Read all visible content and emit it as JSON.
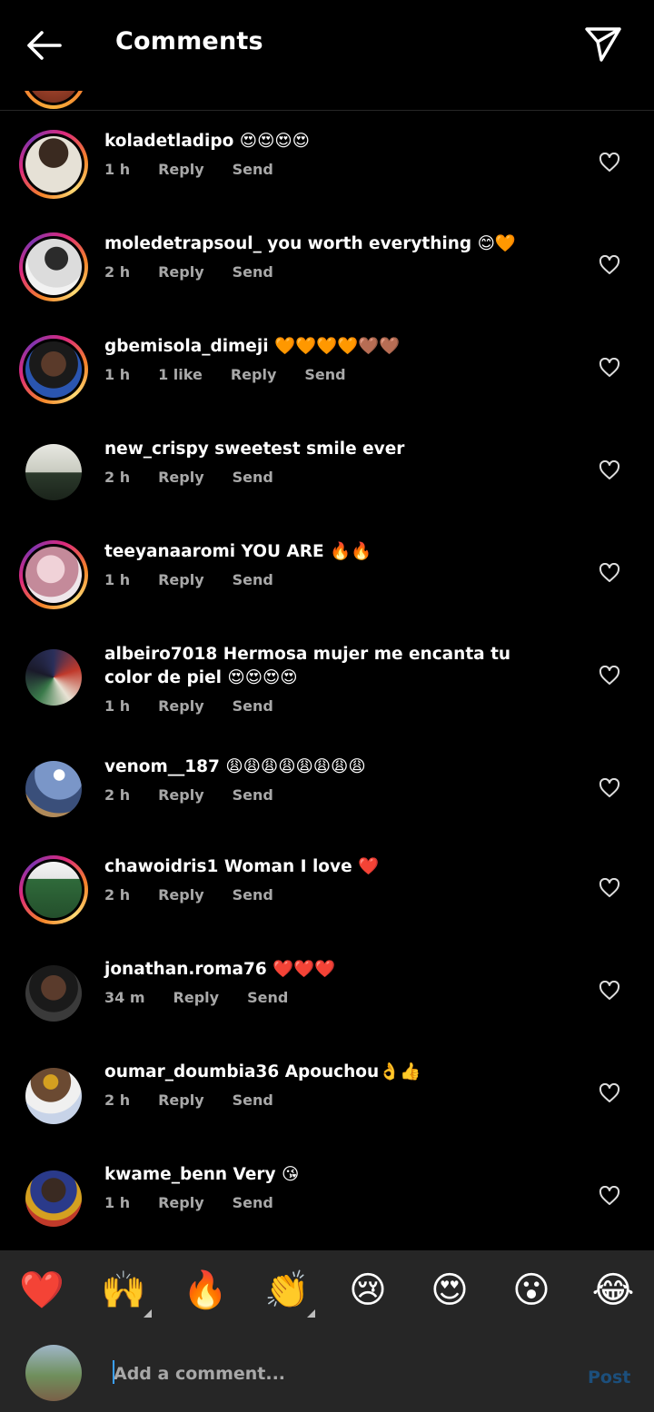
{
  "header": {
    "title": "Comments"
  },
  "comments": [
    {
      "username": "koladetladipo",
      "text": "😍😍😍😍",
      "time": "1 h",
      "likes": "",
      "reply": "Reply",
      "send": "Send"
    },
    {
      "username": "moledetrapsoul_",
      "text": "you worth everything 😊🧡",
      "time": "2 h",
      "likes": "",
      "reply": "Reply",
      "send": "Send"
    },
    {
      "username": "gbemisola_dimeji",
      "text": "🧡🧡🧡🧡🤎🤎",
      "time": "1 h",
      "likes": "1 like",
      "reply": "Reply",
      "send": "Send"
    },
    {
      "username": "new_crispy",
      "text": "sweetest smile ever",
      "time": "2 h",
      "likes": "",
      "reply": "Reply",
      "send": "Send"
    },
    {
      "username": "teeyanaaromi",
      "text": "YOU ARE 🔥🔥",
      "time": "1 h",
      "likes": "",
      "reply": "Reply",
      "send": "Send"
    },
    {
      "username": "albeiro7018",
      "text": "Hermosa mujer me encanta tu color de piel 😍😍😍😍",
      "time": "1 h",
      "likes": "",
      "reply": "Reply",
      "send": "Send"
    },
    {
      "username": "venom__187",
      "text": "😩😩😩😩😩😩😩😩",
      "time": "2 h",
      "likes": "",
      "reply": "Reply",
      "send": "Send"
    },
    {
      "username": "chawoidris1",
      "text": "Woman I love ❤️",
      "time": "2 h",
      "likes": "",
      "reply": "Reply",
      "send": "Send"
    },
    {
      "username": "jonathan.roma76",
      "text": "❤️❤️❤️",
      "time": "34 m",
      "likes": "",
      "reply": "Reply",
      "send": "Send"
    },
    {
      "username": "oumar_doumbia36",
      "text": "Apouchou👌👍",
      "time": "2 h",
      "likes": "",
      "reply": "Reply",
      "send": "Send"
    },
    {
      "username": "kwame_benn",
      "text": "Very 😘",
      "time": "1 h",
      "likes": "",
      "reply": "Reply",
      "send": "Send"
    }
  ],
  "quick_reactions": [
    "❤️",
    "🙌",
    "🔥",
    "👏",
    "😢",
    "😍",
    "😮",
    "😂"
  ],
  "composer": {
    "placeholder": "Add a comment...",
    "post_label": "Post"
  }
}
